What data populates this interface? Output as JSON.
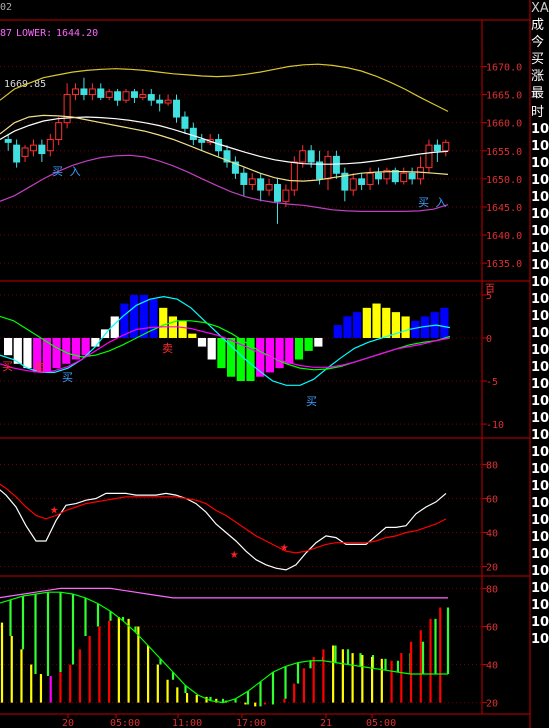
{
  "header": {
    "date_fragment": "02",
    "upper_fragment": "87",
    "lower_label": "LOWER:",
    "lower_value": "1644.20",
    "mid_value": "1669.85"
  },
  "right_panel": {
    "symbol": "XA",
    "rows": [
      "成",
      "今",
      "买",
      "涨",
      "最"
    ],
    "subheader": "时",
    "list_values": [
      "10",
      "10",
      "10",
      "10",
      "10",
      "10",
      "10",
      "10",
      "10",
      "10",
      "10",
      "10",
      "10",
      "10",
      "10",
      "10",
      "10",
      "10",
      "10",
      "10",
      "10",
      "10",
      "10",
      "10",
      "10",
      "10",
      "10",
      "10",
      "10",
      "10",
      "10"
    ]
  },
  "x_axis": {
    "labels": [
      "20",
      "05:00",
      "11:00",
      "17:00",
      "21",
      "05:00"
    ]
  },
  "chart_data": [
    {
      "type": "candlestick",
      "yticks": [
        1635.0,
        1640.0,
        1645.0,
        1650.0,
        1655.0,
        1660.0,
        1665.0,
        1670.0
      ],
      "ylim": [
        1632,
        1674
      ],
      "annotations": [
        "买 入",
        "买 入"
      ],
      "candles": [
        [
          1657,
          1656.5,
          1655,
          1658
        ],
        [
          1656,
          1653,
          1652,
          1657
        ],
        [
          1654,
          1655.5,
          1653,
          1656
        ],
        [
          1655,
          1656,
          1654,
          1657
        ],
        [
          1656,
          1654.5,
          1653,
          1657
        ],
        [
          1655,
          1657,
          1654,
          1658
        ],
        [
          1657,
          1660,
          1656,
          1661
        ],
        [
          1660,
          1665,
          1659,
          1667
        ],
        [
          1665,
          1666,
          1664,
          1667
        ],
        [
          1666,
          1665,
          1664,
          1668
        ],
        [
          1665,
          1666,
          1664,
          1667
        ],
        [
          1666,
          1664.5,
          1664,
          1667
        ],
        [
          1664.5,
          1665.5,
          1664,
          1666
        ],
        [
          1665.5,
          1664,
          1663,
          1666
        ],
        [
          1664,
          1665.5,
          1663.5,
          1666
        ],
        [
          1665.5,
          1664.5,
          1663.5,
          1666
        ],
        [
          1664.5,
          1665,
          1664,
          1666
        ],
        [
          1665,
          1664,
          1663,
          1666
        ],
        [
          1664,
          1663.5,
          1662,
          1665
        ],
        [
          1663.5,
          1664,
          1663,
          1665
        ],
        [
          1664,
          1661,
          1660,
          1665
        ],
        [
          1661,
          1659,
          1658,
          1662
        ],
        [
          1659,
          1657,
          1656,
          1660
        ],
        [
          1657,
          1656.5,
          1655,
          1658
        ],
        [
          1656.5,
          1657,
          1656,
          1658
        ],
        [
          1657,
          1655,
          1654,
          1658
        ],
        [
          1655,
          1653,
          1652,
          1656
        ],
        [
          1653,
          1651,
          1650,
          1654
        ],
        [
          1651,
          1649,
          1647,
          1652
        ],
        [
          1649,
          1650,
          1648,
          1651
        ],
        [
          1650,
          1648,
          1646,
          1651
        ],
        [
          1648,
          1649,
          1647,
          1650
        ],
        [
          1649,
          1646,
          1642,
          1650
        ],
        [
          1646,
          1648,
          1645,
          1649
        ],
        [
          1648,
          1653,
          1647,
          1654
        ],
        [
          1653,
          1655,
          1652,
          1656
        ],
        [
          1655,
          1653,
          1652,
          1656
        ],
        [
          1653,
          1650,
          1649,
          1655
        ],
        [
          1650,
          1654,
          1648,
          1655
        ],
        [
          1654,
          1651,
          1650,
          1655
        ],
        [
          1651,
          1648,
          1646,
          1652
        ],
        [
          1648,
          1650,
          1647,
          1651
        ],
        [
          1650,
          1649,
          1648,
          1651
        ],
        [
          1649,
          1651,
          1648,
          1652
        ],
        [
          1651,
          1650,
          1649,
          1652
        ],
        [
          1650,
          1651.5,
          1649,
          1652
        ],
        [
          1651.5,
          1649.5,
          1649,
          1652
        ],
        [
          1649.5,
          1651,
          1649,
          1652
        ],
        [
          1651,
          1650,
          1649,
          1652
        ],
        [
          1650,
          1652,
          1649,
          1654
        ],
        [
          1652,
          1656,
          1651,
          1657
        ],
        [
          1656,
          1655,
          1653,
          1657
        ],
        [
          1655,
          1656.5,
          1654,
          1657
        ]
      ],
      "series": [
        {
          "name": "upper",
          "color": "#d8c830",
          "values": [
            1664,
            1666,
            1667,
            1668,
            1668.5,
            1669,
            1669.3,
            1669.5,
            1669.6,
            1669.5,
            1669.3,
            1669,
            1668.7,
            1668.5,
            1668.3,
            1668.2,
            1668.3,
            1668.6,
            1669,
            1669.5,
            1670,
            1670.3,
            1670.4,
            1670.2,
            1669.8,
            1669.2,
            1668.3,
            1667.2,
            1666,
            1664.6,
            1663.3,
            1662
          ]
        },
        {
          "name": "mid",
          "color": "#ffffff",
          "values": [
            1657,
            1658.5,
            1659.5,
            1660.3,
            1660.7,
            1660.9,
            1661,
            1660.9,
            1660.7,
            1660.4,
            1660,
            1659.5,
            1658.8,
            1658,
            1657.2,
            1656.3,
            1655.5,
            1654.7,
            1654,
            1653.4,
            1653,
            1652.7,
            1652.6,
            1652.6,
            1652.7,
            1652.9,
            1653.2,
            1653.6,
            1654,
            1654.4,
            1654.7,
            1654.9
          ]
        },
        {
          "name": "ma",
          "color": "#f0e08a",
          "values": [
            1658,
            1660,
            1661,
            1661.3,
            1661.2,
            1661,
            1660.5,
            1660,
            1659.5,
            1659,
            1658.5,
            1657.8,
            1657,
            1656,
            1655,
            1654,
            1653,
            1652,
            1651,
            1650.2,
            1649.7,
            1649.6,
            1649.8,
            1650.2,
            1650.6,
            1651,
            1651.2,
            1651.3,
            1651.3,
            1651.2,
            1651,
            1650.8
          ]
        },
        {
          "name": "lower",
          "color": "#c040c0",
          "values": [
            1646,
            1647,
            1648.5,
            1650,
            1651.3,
            1652.4,
            1653.2,
            1653.8,
            1654.1,
            1654.2,
            1653.9,
            1653.2,
            1652.3,
            1651.2,
            1650,
            1648.8,
            1647.7,
            1646.8,
            1646.2,
            1645.8,
            1645.5,
            1645.3,
            1644.9,
            1644.5,
            1644.3,
            1644.2,
            1644.2,
            1644.2,
            1644.2,
            1644.3,
            1644.6,
            1645.4
          ]
        }
      ]
    },
    {
      "type": "bar",
      "yticks": [
        -10,
        -5,
        0,
        5
      ],
      "ylim": [
        -11.5,
        6.5
      ],
      "annotations": [
        "买",
        "卖",
        "买",
        "卖",
        "买"
      ],
      "bars": [
        [
          -2,
          "#ffffff"
        ],
        [
          -3,
          "#ffffff"
        ],
        [
          -3.5,
          "#ffffff"
        ],
        [
          -4,
          "#ff00ff"
        ],
        [
          -4,
          "#ff00ff"
        ],
        [
          -3.5,
          "#ff00ff"
        ],
        [
          -3,
          "#ff00ff"
        ],
        [
          -2.5,
          "#ff00ff"
        ],
        [
          -2,
          "#ff00ff"
        ],
        [
          -1,
          "#ffffff"
        ],
        [
          1,
          "#ffffff"
        ],
        [
          2.5,
          "#ffffff"
        ],
        [
          4,
          "#0000ff"
        ],
        [
          5,
          "#0000ff"
        ],
        [
          5,
          "#0000ff"
        ],
        [
          4.5,
          "#0000ff"
        ],
        [
          3.5,
          "#ffff00"
        ],
        [
          2.5,
          "#ffff00"
        ],
        [
          2,
          "#ffff00"
        ],
        [
          0.5,
          "#ffff00"
        ],
        [
          -1,
          "#ffffff"
        ],
        [
          -2.5,
          "#ffffff"
        ],
        [
          -3.5,
          "#00ff00"
        ],
        [
          -4.5,
          "#00ff00"
        ],
        [
          -5,
          "#00ff00"
        ],
        [
          -5,
          "#00ff00"
        ],
        [
          -4.5,
          "#ff00ff"
        ],
        [
          -4,
          "#ff00ff"
        ],
        [
          -3.5,
          "#ff00ff"
        ],
        [
          -3,
          "#ff00ff"
        ],
        [
          -2.5,
          "#00ff00"
        ],
        [
          -1.5,
          "#00ff00"
        ],
        [
          -1,
          "#ffffff"
        ],
        [
          0,
          "#ffffff"
        ],
        [
          1.5,
          "#0000ff"
        ],
        [
          2.5,
          "#0000ff"
        ],
        [
          3,
          "#0000ff"
        ],
        [
          3.5,
          "#ffff00"
        ],
        [
          4,
          "#ffff00"
        ],
        [
          3.5,
          "#ffff00"
        ],
        [
          3,
          "#ffff00"
        ],
        [
          2.5,
          "#ffff00"
        ],
        [
          2,
          "#0000ff"
        ],
        [
          2.5,
          "#0000ff"
        ],
        [
          3,
          "#0000ff"
        ],
        [
          3.5,
          "#0000ff"
        ]
      ],
      "series": [
        {
          "color": "#00ffff",
          "values": [
            -2,
            -2.5,
            -3.5,
            -4,
            -4,
            -3.5,
            -2.5,
            -1,
            1,
            2.5,
            3.8,
            4.5,
            4.8,
            4.5,
            3.5,
            2,
            0.5,
            -1,
            -2.5,
            -3.8,
            -5,
            -5.5,
            -5.5,
            -4.8,
            -3.5,
            -2.3,
            -1.2,
            -0.5,
            0,
            0.5,
            1,
            1.3,
            1.5,
            1.2
          ]
        },
        {
          "color": "#00ff00",
          "values": [
            2.5,
            2,
            1,
            0,
            -1,
            -1.8,
            -2.2,
            -2,
            -1.5,
            -0.8,
            0,
            0.8,
            1.5,
            2,
            2,
            1.8,
            1.3,
            0.5,
            -0.5,
            -1.5,
            -2.3,
            -3,
            -3.5,
            -3.7,
            -3.6,
            -3.3,
            -2.8,
            -2.3,
            -1.8,
            -1.3,
            -0.8,
            -0.5,
            -0.3,
            0.2
          ]
        },
        {
          "color": "#ff00ff",
          "values": [
            -3,
            -3.5,
            -3.8,
            -4,
            -3.8,
            -3.3,
            -2.5,
            -1.5,
            -0.5,
            0.3,
            1,
            1.2,
            1.3,
            1.3,
            1.1,
            0.7,
            0.3,
            -0.3,
            -1,
            -1.7,
            -2.3,
            -2.8,
            -3.2,
            -3.4,
            -3.4,
            -3.2,
            -2.8,
            -2.3,
            -1.8,
            -1.3,
            -1,
            -0.7,
            -0.3,
            0
          ]
        }
      ]
    },
    {
      "type": "line",
      "yticks": [
        20,
        40,
        60,
        80
      ],
      "ylim": [
        15,
        95
      ],
      "series": [
        {
          "color": "#ffffff",
          "values": [
            67,
            62,
            55,
            44,
            35,
            35,
            47,
            56,
            57,
            59,
            60,
            63,
            63,
            63,
            62,
            62,
            62,
            63,
            62,
            60,
            57,
            52,
            45,
            40,
            35,
            29,
            24,
            21,
            19,
            18,
            21,
            28,
            34,
            38,
            37,
            33,
            33,
            33,
            38,
            43,
            43,
            44,
            51,
            55,
            58,
            63
          ]
        },
        {
          "color": "#ff0000",
          "values": [
            70,
            66,
            61,
            55,
            50,
            48,
            50,
            53,
            55,
            57,
            58,
            59,
            60,
            61,
            61,
            61,
            61,
            61,
            61,
            60,
            59,
            57,
            53,
            50,
            46,
            42,
            38,
            35,
            32,
            29,
            28,
            29,
            31,
            33,
            34,
            34,
            34,
            34,
            35,
            37,
            38,
            40,
            41,
            43,
            45,
            48
          ]
        }
      ],
      "markers": [
        [
          6,
          54
        ],
        [
          24,
          28
        ],
        [
          29,
          32
        ]
      ]
    },
    {
      "type": "bar",
      "yticks": [
        20,
        40,
        60,
        80
      ],
      "ylim": [
        14,
        86
      ],
      "bars": [
        [
          62,
          "#ffff00"
        ],
        [
          55,
          "#ffff00"
        ],
        [
          48,
          "#ffff00"
        ],
        [
          40,
          "#ffff00"
        ],
        [
          35,
          "#ffff00"
        ],
        [
          34,
          "#ff00ff"
        ],
        [
          36,
          "#ff0000"
        ],
        [
          40,
          "#ff0000"
        ],
        [
          48,
          "#ff0000"
        ],
        [
          55,
          "#ff0000"
        ],
        [
          60,
          "#ff0000"
        ],
        [
          63,
          "#ff0000"
        ],
        [
          65,
          "#ffff00"
        ],
        [
          64,
          "#ffff00"
        ],
        [
          60,
          "#ffff00"
        ],
        [
          50,
          "#ffff00"
        ],
        [
          40,
          "#ffff00"
        ],
        [
          32,
          "#ffff00"
        ],
        [
          28,
          "#ffff00"
        ],
        [
          25,
          "#ffff00"
        ],
        [
          24,
          "#ffff00"
        ],
        [
          23,
          "#ffff00"
        ],
        [
          22,
          "#ffff00"
        ],
        [
          21,
          "#ffff00"
        ],
        [
          20,
          "#ffff00"
        ],
        [
          19,
          "#ffff00"
        ],
        [
          18,
          "#ffff00"
        ],
        [
          19,
          "#ff0000"
        ],
        [
          20,
          "#ff0000"
        ],
        [
          22,
          "#ff0000"
        ],
        [
          30,
          "#ff0000"
        ],
        [
          38,
          "#ff0000"
        ],
        [
          44,
          "#ff0000"
        ],
        [
          48,
          "#ff0000"
        ],
        [
          50,
          "#ffff00"
        ],
        [
          48,
          "#ffff00"
        ],
        [
          46,
          "#ffff00"
        ],
        [
          45,
          "#ffff00"
        ],
        [
          44,
          "#ffff00"
        ],
        [
          43,
          "#ffff00"
        ],
        [
          42,
          "#ff0000"
        ],
        [
          46,
          "#ff0000"
        ],
        [
          52,
          "#ff0000"
        ],
        [
          58,
          "#ff0000"
        ],
        [
          64,
          "#ff0000"
        ],
        [
          70,
          "#ff0000"
        ]
      ],
      "lines": [
        {
          "color": "#ff66ff",
          "values": [
            75,
            76,
            77,
            78,
            79,
            80,
            80,
            80,
            80,
            80,
            79,
            78,
            77,
            76,
            75,
            75,
            75,
            75,
            75,
            75,
            75,
            75,
            75,
            75,
            75,
            75,
            75,
            75,
            75,
            75,
            75,
            75,
            75,
            75,
            75,
            75,
            75
          ]
        },
        {
          "color": "#00ff00",
          "values": [
            72,
            74,
            76,
            77,
            78,
            78,
            77,
            75,
            72,
            68,
            63,
            57,
            50,
            43,
            36,
            29,
            24,
            21,
            20,
            22,
            26,
            31,
            36,
            39,
            41,
            42,
            42,
            41,
            40,
            39,
            38,
            37,
            36,
            35,
            35,
            35,
            35
          ]
        }
      ]
    }
  ]
}
